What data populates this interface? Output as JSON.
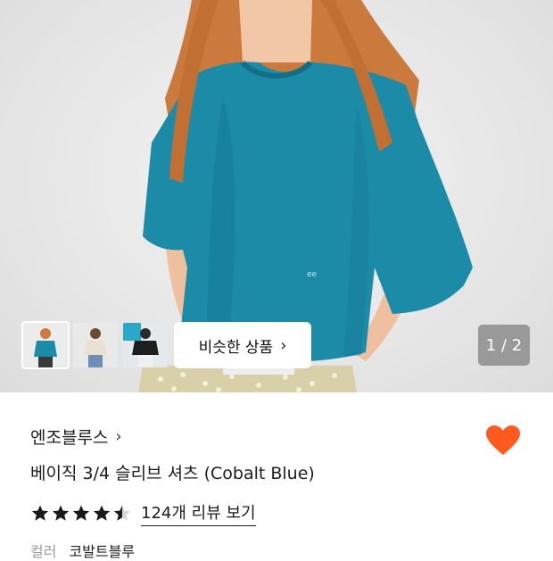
{
  "gallery": {
    "similar_label": "비슷한 상품",
    "similar_chevron": "›",
    "pager_text": "1 / 2",
    "thumbnails": [
      "thumbnail-1",
      "thumbnail-2",
      "thumbnail-3"
    ]
  },
  "product": {
    "brand": "엔조블루스",
    "brand_chevron": "›",
    "title": "베이직 3/4 슬리브 셔츠 (Cobalt Blue)",
    "rating": 4.5,
    "review_link": "124개 리뷰 보기",
    "option_label": "컬러",
    "option_value": "코발트블루"
  },
  "colors": {
    "heart": "#ff5a1f",
    "shirt": "#1b8ba8",
    "star": "#1a1a1a"
  },
  "icons": {
    "heart": "heart-icon",
    "star": "star-icon",
    "chevron": "chevron-right-icon"
  }
}
